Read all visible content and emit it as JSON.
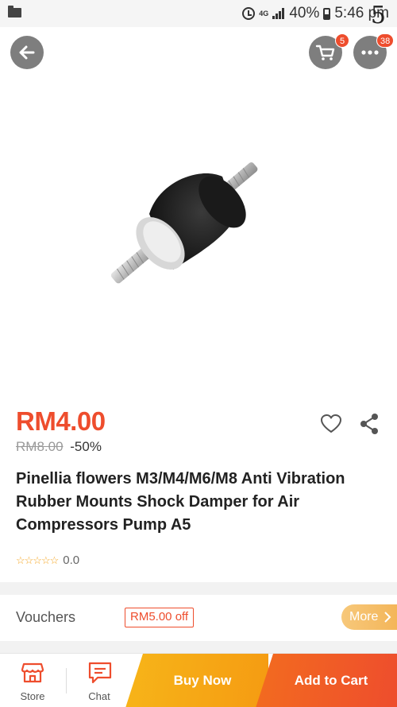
{
  "status_bar": {
    "network": "4G",
    "battery": "40%",
    "time": "5:46 pm",
    "overlay_digit": "5"
  },
  "top_actions": {
    "cart_badge": "5",
    "more_badge": "38"
  },
  "product": {
    "price": "RM4.00",
    "original_price": "RM8.00",
    "discount": "-50%",
    "title": "Pinellia flowers M3/M4/M6/M8 Anti Vibration Rubber Mounts Shock Damper for Air Compressors Pump A5",
    "stars": "☆☆☆☆☆",
    "rating": "0.0"
  },
  "vouchers": {
    "label": "Vouchers",
    "tag": "RM5.00 off",
    "more": "More"
  },
  "bottom_bar": {
    "store": "Store",
    "chat": "Chat",
    "buy_now": "Buy Now",
    "add_to_cart": "Add to Cart"
  },
  "colors": {
    "accent": "#ee4d2d",
    "buy_now": "#f7b519",
    "more_pill": "#f3b457"
  },
  "icons": [
    "folder-icon",
    "alarm-icon",
    "signal-icon",
    "battery-icon",
    "back-arrow-icon",
    "cart-icon",
    "more-dots-icon",
    "heart-icon",
    "share-icon",
    "store-icon",
    "chat-icon",
    "chevron-right-icon"
  ]
}
